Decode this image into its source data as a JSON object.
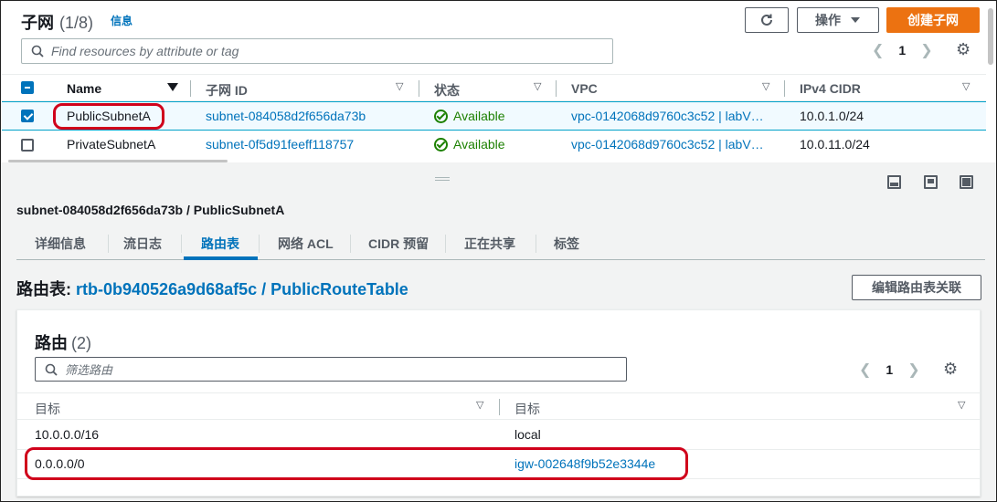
{
  "subnets": {
    "title": "子网",
    "count": "(1/8)",
    "info_link": "信息",
    "actions_label": "操作",
    "create_label": "创建子网",
    "search_placeholder": "Find resources by attribute or tag",
    "page": "1",
    "columns": [
      "Name",
      "子网 ID",
      "状态",
      "VPC",
      "IPv4 CIDR"
    ],
    "rows": [
      {
        "name": "PublicSubnetA",
        "subnet_id": "subnet-084058d2f656da73b",
        "status": "Available",
        "vpc": "vpc-0142068d9760c3c52 | labV…",
        "cidr": "10.0.1.0/24",
        "selected": true
      },
      {
        "name": "PrivateSubnetA",
        "subnet_id": "subnet-0f5d91feeff118757",
        "status": "Available",
        "vpc": "vpc-0142068d9760c3c52 | labV…",
        "cidr": "10.0.11.0/24",
        "selected": false
      }
    ]
  },
  "detail": {
    "title": "subnet-084058d2f656da73b / PublicSubnetA",
    "tabs": [
      "详细信息",
      "流日志",
      "路由表",
      "网络 ACL",
      "CIDR 预留",
      "正在共享",
      "标签"
    ],
    "active_tab": "路由表",
    "route_table_label": "路由表:",
    "route_table_value": "rtb-0b940526a9d68af5c / PublicRouteTable",
    "edit_button": "编辑路由表关联",
    "routes": {
      "title": "路由",
      "count": "(2)",
      "search_placeholder": "筛选路由",
      "page": "1",
      "columns": [
        "目标",
        "目标"
      ],
      "rows": [
        {
          "destination": "10.0.0.0/16",
          "target": "local",
          "target_is_link": false
        },
        {
          "destination": "0.0.0.0/0",
          "target": "igw-002648f9b52e3344e",
          "target_is_link": true
        }
      ]
    }
  },
  "colors": {
    "primary": "#ec7211",
    "link": "#0073bb",
    "success": "#1d8102",
    "highlight": "#d0021b"
  }
}
